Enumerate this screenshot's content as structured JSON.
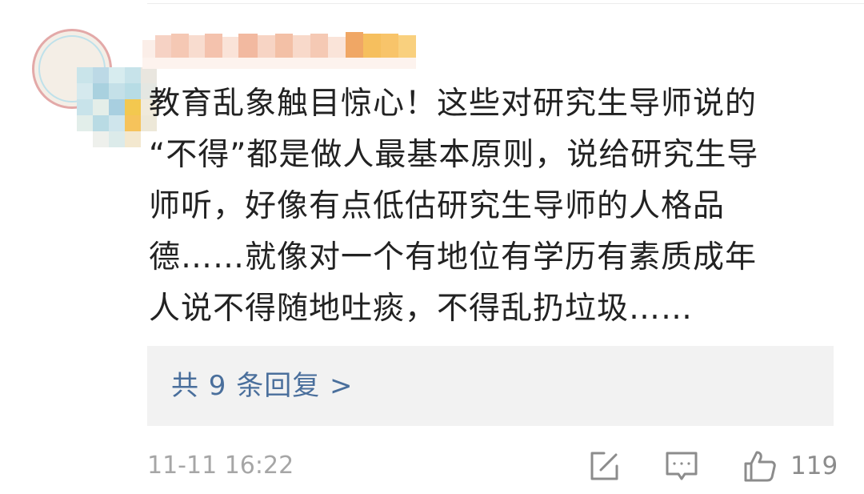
{
  "comment": {
    "username": "",
    "lines": [
      "教育乱象触目惊心！这些对研究生导师说的",
      "“不得”都是做人最基本原则，说给研究生导",
      "师听，好像有点低估研究生导师的人格品",
      "德……就像对一个有地位有学历有素质成年",
      "人说不得随地吐痰，不得乱扔垃圾……"
    ]
  },
  "replies": {
    "label": "共 9 条回复 >"
  },
  "footer": {
    "time": "11-11 16:22",
    "like_count": "119",
    "icons": [
      "edit-icon",
      "comment-icon",
      "thumbs-up-icon"
    ]
  },
  "colors": {
    "link": "#4a6f9c",
    "text": "#222222",
    "meta": "#a6a6a6",
    "reply_bg": "#f2f2f2"
  }
}
